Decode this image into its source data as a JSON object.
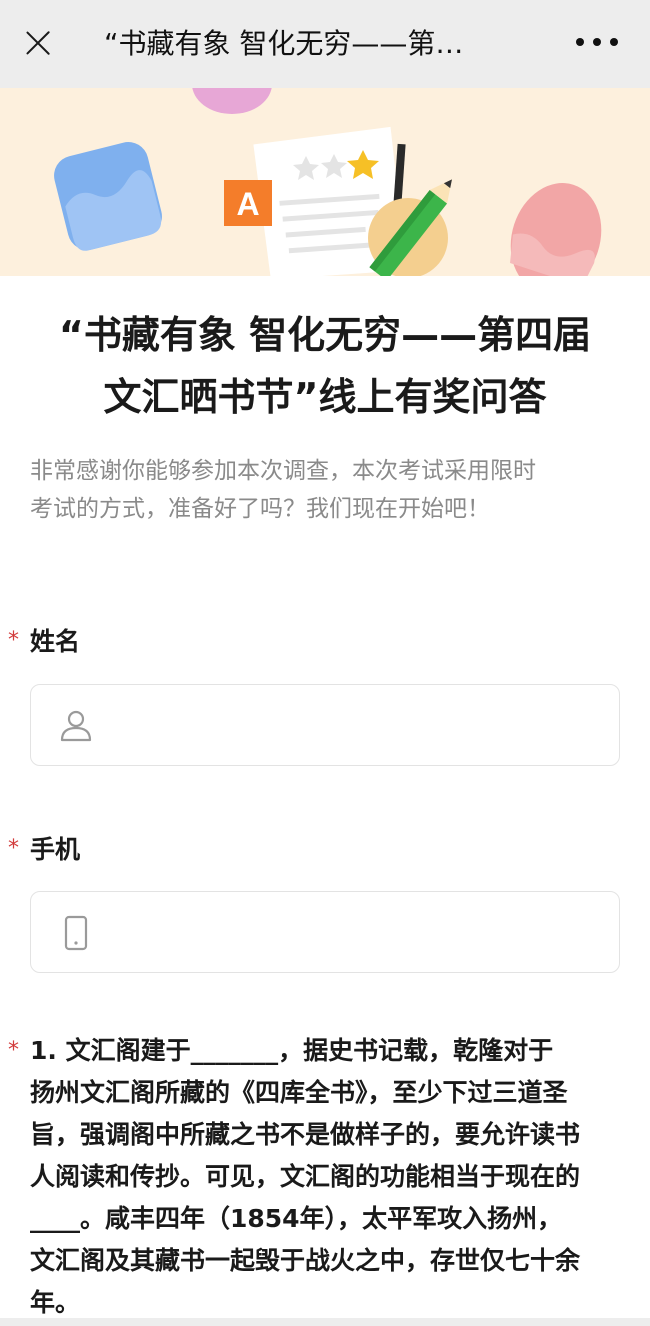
{
  "header": {
    "title": "“书藏有象 智化无穷——第…",
    "close_icon": "close-icon",
    "more_icon": "more-icon"
  },
  "banner": {
    "badge_letter": "A",
    "colors": {
      "background": "#fdf0dd",
      "badge": "#f47d2a",
      "star": "#f6c026",
      "pencil": "#3cb54a"
    }
  },
  "survey": {
    "title_line1": "“书藏有象 智化无穷——第四届",
    "title_line2": "文汇晒书节”线上有奖问答",
    "desc_line1": "非常感谢你能够参加本次调查，本次考试采用限时",
    "desc_line2": "考试的方式，准备好了吗？我们现在开始吧！"
  },
  "form": {
    "required_mark": "*",
    "name": {
      "label": "姓名",
      "icon": "user-icon",
      "value": ""
    },
    "phone": {
      "label": "手机",
      "icon": "phone-icon",
      "value": ""
    }
  },
  "question1": {
    "lines": [
      "1. 文汇阁建于_______，据史书记载，乾隆对于",
      "扬州文汇阁所藏的《四库全书》，至少下过三道圣",
      "旨，强调阁中所藏之书不是做样子的，要允许读书",
      "人阅读和传抄。可见，文汇阁的功能相当于现在的",
      "____。咸丰四年（1854年），太平军攻入扬州，",
      "文汇阁及其藏书一起毁于战火之中，存世仅七十余",
      "年。"
    ]
  }
}
